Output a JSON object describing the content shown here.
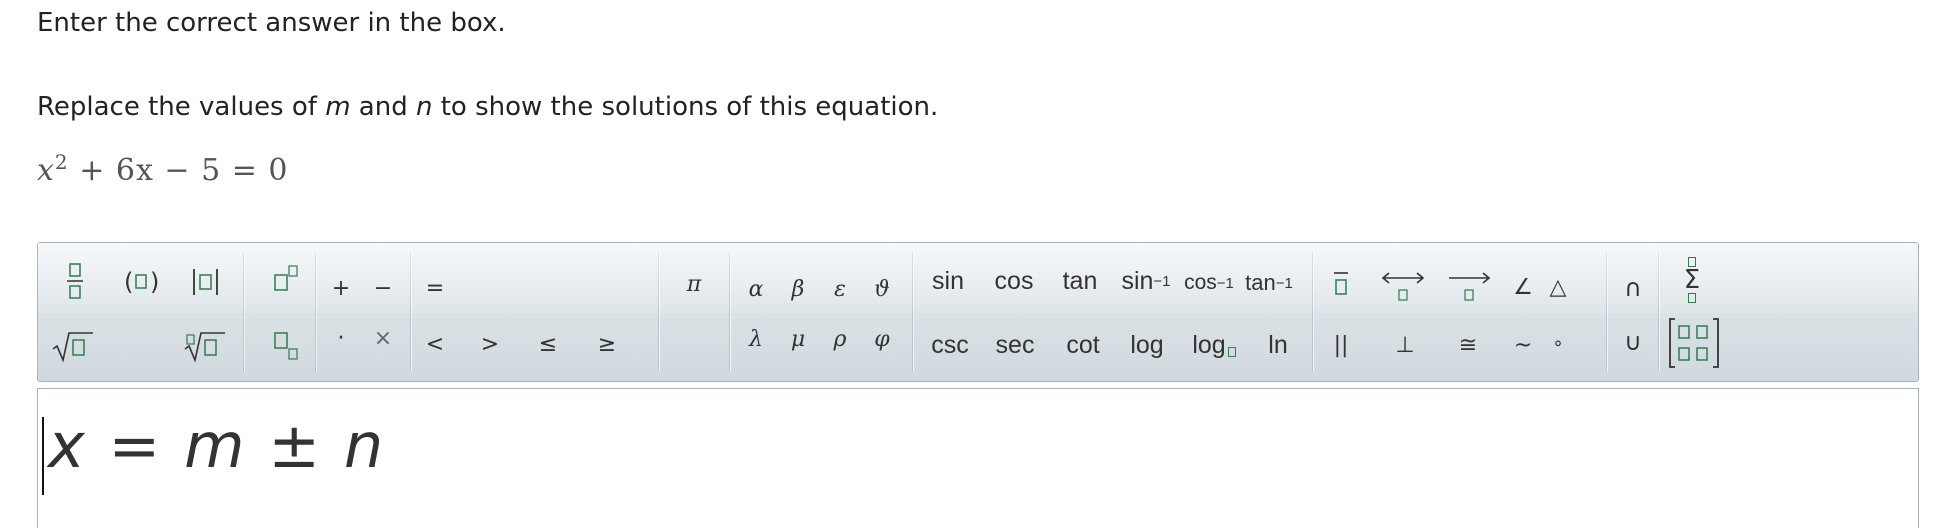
{
  "instruction": "Enter the correct answer in the box.",
  "prompt": {
    "before": "Replace the values of ",
    "var_m": "m",
    "middle": " and ",
    "var_n": "n",
    "after": " to show the solutions of this equation."
  },
  "equation": {
    "base": "x",
    "exponent": "2",
    "rest": " + 6x − 5 = 0"
  },
  "toolbar": {
    "constants": {
      "pi": "π"
    },
    "greek_top": [
      "α",
      "β",
      "ε",
      "ϑ"
    ],
    "greek_bottom": [
      "λ",
      "μ",
      "ρ",
      "φ"
    ],
    "trig_top": {
      "sin": "sin",
      "cos": "cos",
      "tan": "tan",
      "arcsin": "sin",
      "arccos": "cos",
      "arctan": "tan",
      "inverse_exp": "−1"
    },
    "trig_bottom": {
      "csc": "csc",
      "sec": "sec",
      "cot": "cot",
      "log": "log",
      "logn": "log",
      "ln": "ln"
    },
    "ops": {
      "plus": "+",
      "minus": "−",
      "equals": "=",
      "dot": "·",
      "times": "×",
      "lt": "<",
      "gt": ">",
      "le": "≤",
      "ge": "≥"
    },
    "geometry": {
      "parallel": "||",
      "perp": "⊥",
      "congruent": "≅",
      "similar": "~",
      "degree": "∘",
      "angle": "∠",
      "triangle": "△"
    },
    "sets": {
      "intersect": "∩",
      "union": "∪"
    },
    "sigma": "Σ"
  },
  "answer": {
    "x": "x",
    "eq": "=",
    "m": "m",
    "pm": "±",
    "n": "n"
  }
}
